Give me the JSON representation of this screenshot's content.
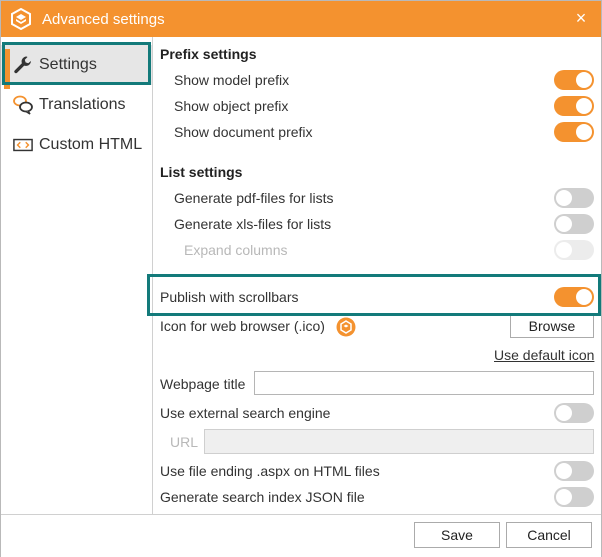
{
  "window": {
    "title": "Advanced settings",
    "close_glyph": "×",
    "accent_color": "#f4922f",
    "highlight_color": "#137a7a"
  },
  "sidebar": {
    "items": [
      {
        "label": "Settings",
        "icon": "wrench-icon",
        "active": true
      },
      {
        "label": "Translations",
        "icon": "speech-bubbles-icon",
        "active": false
      },
      {
        "label": "Custom HTML",
        "icon": "code-tag-icon",
        "active": false
      }
    ]
  },
  "prefix": {
    "title": "Prefix settings",
    "model": {
      "label": "Show model prefix",
      "on": true
    },
    "object": {
      "label": "Show object prefix",
      "on": true
    },
    "document": {
      "label": "Show document prefix",
      "on": true
    }
  },
  "list": {
    "title": "List settings",
    "pdf": {
      "label": "Generate pdf-files for lists",
      "on": false
    },
    "xls": {
      "label": "Generate xls-files for lists",
      "on": false
    },
    "expand": {
      "label": "Expand columns",
      "on": false,
      "disabled": true
    }
  },
  "publish": {
    "scrollbars": {
      "label": "Publish with scrollbars",
      "on": true
    },
    "icon_label": "Icon for web browser (.ico)",
    "browse_label": "Browse",
    "default_icon_link": "Use default icon",
    "webpage_title_label": "Webpage title",
    "webpage_title_value": "",
    "external_search": {
      "label": "Use external search engine",
      "on": false
    },
    "url_label": "URL",
    "url_value": "",
    "aspx": {
      "label": "Use file ending .aspx on HTML files",
      "on": false
    },
    "json": {
      "label": "Generate search index JSON file",
      "on": false
    }
  },
  "footer": {
    "save_label": "Save",
    "cancel_label": "Cancel"
  }
}
